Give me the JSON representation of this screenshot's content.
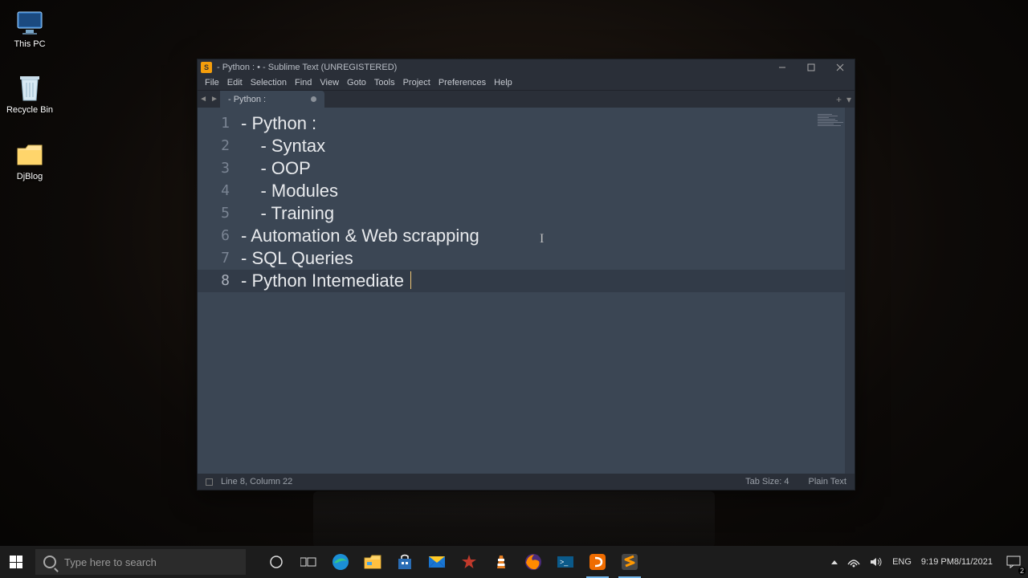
{
  "desktop": {
    "icons": [
      {
        "label": "This PC"
      },
      {
        "label": "Recycle Bin"
      },
      {
        "label": "DjBlog"
      }
    ]
  },
  "sublime": {
    "title": "- Python : • - Sublime Text (UNREGISTERED)",
    "menu": [
      "File",
      "Edit",
      "Selection",
      "Find",
      "View",
      "Goto",
      "Tools",
      "Project",
      "Preferences",
      "Help"
    ],
    "tab_label": "- Python :",
    "lines": [
      "- Python :",
      "    - Syntax",
      "    - OOP",
      "    - Modules",
      "    - Training",
      "- Automation & Web scrapping",
      "- SQL Queries",
      "- Python Intemediate "
    ],
    "active_line_index": 7,
    "status": {
      "pos": "Line 8, Column 22",
      "tabsize": "Tab Size: 4",
      "syntax": "Plain Text"
    }
  },
  "taskbar": {
    "search_placeholder": "Type here to search",
    "tray": {
      "lang": "ENG",
      "time": "9:19 PM",
      "date": "8/11/2021",
      "notif_count": "2"
    }
  }
}
